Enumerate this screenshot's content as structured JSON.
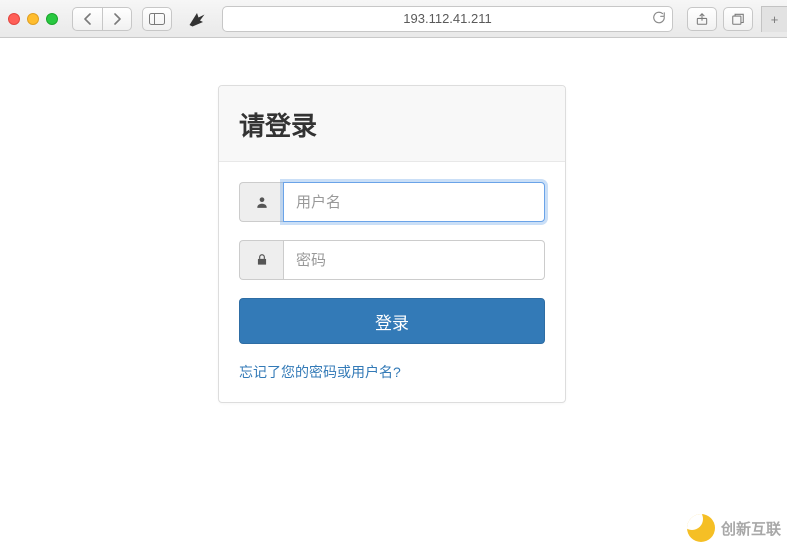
{
  "browser": {
    "address": "193.112.41.211"
  },
  "login": {
    "heading": "请登录",
    "username_placeholder": "用户名",
    "password_placeholder": "密码",
    "submit_label": "登录",
    "forgot_text": "忘记了您的密码或用户名?"
  },
  "watermark": {
    "text": "创新互联"
  }
}
